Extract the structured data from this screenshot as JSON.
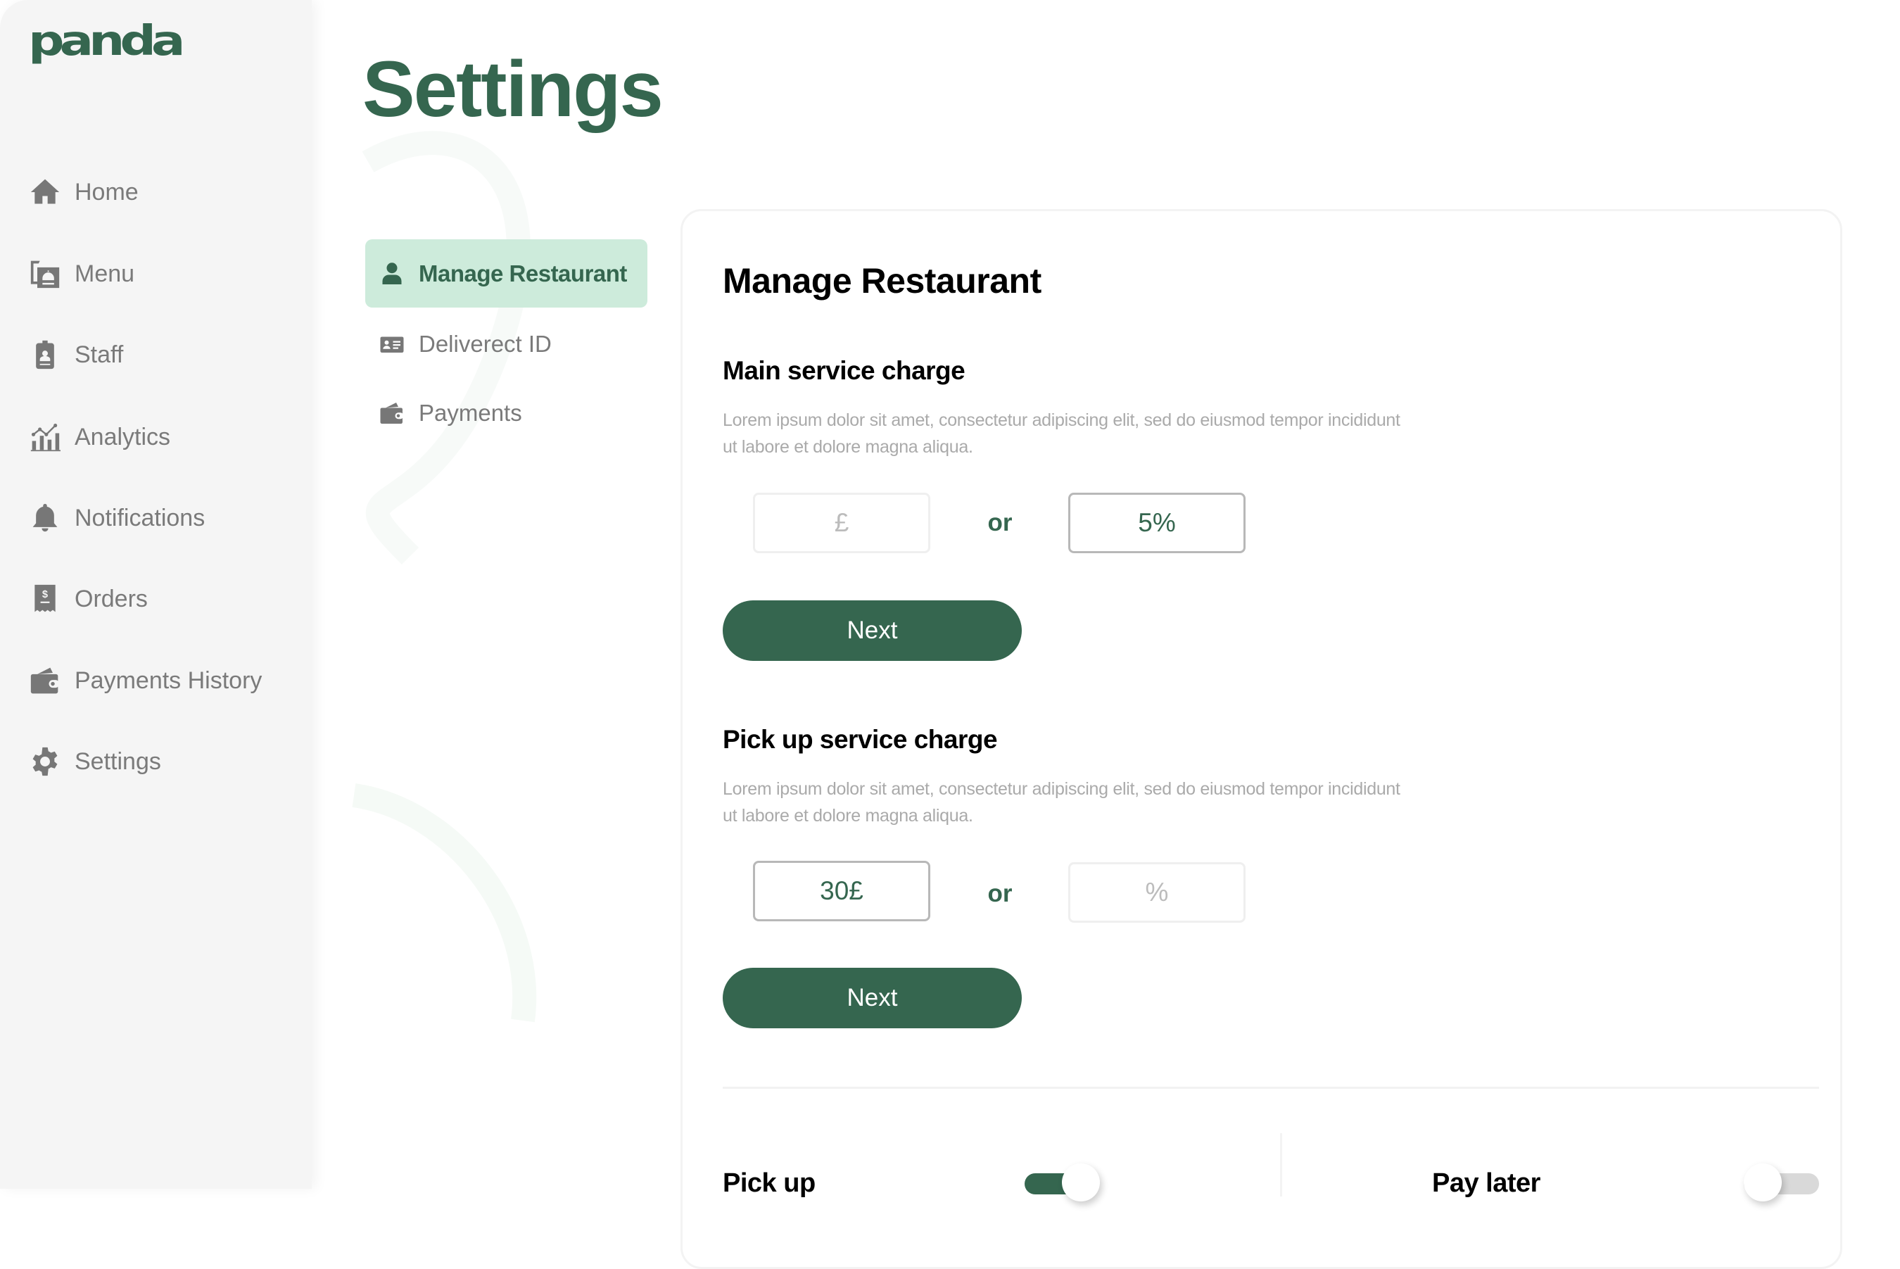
{
  "brand": {
    "logo_text": "panda",
    "accent_color": "#35664f",
    "active_bg": "#cdebdb"
  },
  "sidebar": {
    "items": [
      {
        "label": "Home",
        "icon": "home-icon"
      },
      {
        "label": "Menu",
        "icon": "menu-book-icon"
      },
      {
        "label": "Staff",
        "icon": "staff-badge-icon"
      },
      {
        "label": "Analytics",
        "icon": "analytics-icon"
      },
      {
        "label": "Notifications",
        "icon": "bell-icon"
      },
      {
        "label": "Orders",
        "icon": "receipt-icon"
      },
      {
        "label": "Payments History",
        "icon": "wallet-icon"
      },
      {
        "label": "Settings",
        "icon": "gear-icon"
      }
    ]
  },
  "page": {
    "title": "Settings"
  },
  "settings_nav": {
    "items": [
      {
        "label": "Manage Restaurant",
        "icon": "user-icon",
        "active": true
      },
      {
        "label": "Deliverect ID",
        "icon": "id-card-icon",
        "active": false
      },
      {
        "label": "Payments",
        "icon": "wallet-icon",
        "active": false
      }
    ]
  },
  "card": {
    "title": "Manage Restaurant",
    "main_service_charge": {
      "heading": "Main service charge",
      "description": "Lorem ipsum dolor sit amet, consectetur adipiscing elit, sed do eiusmod tempor incididunt ut labore et dolore magna aliqua.",
      "amount_placeholder": "£",
      "amount_value": "",
      "or_label": "or",
      "percent_value": "5%",
      "percent_placeholder": "%",
      "next_label": "Next"
    },
    "pickup_service_charge": {
      "heading": "Pick up service charge",
      "description": "Lorem ipsum dolor sit amet, consectetur adipiscing elit, sed do eiusmod tempor incididunt ut labore et dolore magna aliqua.",
      "amount_value": "30£",
      "amount_placeholder": "£",
      "or_label": "or",
      "percent_value": "",
      "percent_placeholder": "%",
      "next_label": "Next"
    },
    "toggles": [
      {
        "label": "Pick up",
        "on": true
      },
      {
        "label": "Pay later",
        "on": false
      }
    ]
  }
}
